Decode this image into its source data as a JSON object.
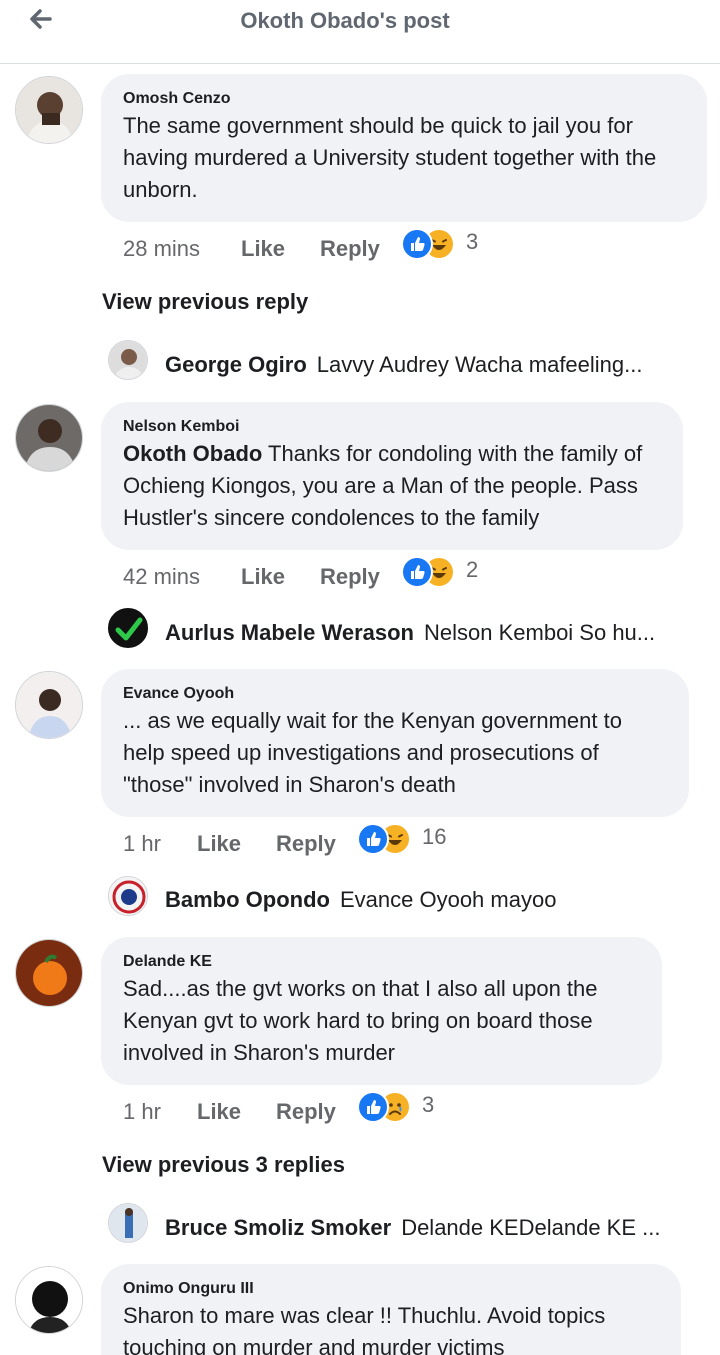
{
  "header": {
    "title": "Okoth Obado's post",
    "back_icon": "back-arrow-icon"
  },
  "comments": [
    {
      "author": "Omosh Cenzo",
      "text": "The same government should be quick to jail you for having murdered a University student together with the unborn.",
      "time": "28 mins",
      "like": "Like",
      "reply": "Reply",
      "reaction_count": "3",
      "reactions": [
        "like",
        "haha"
      ]
    },
    {
      "author": "Nelson Kemboi",
      "mention": "Okoth Obado",
      "text": " Thanks for condoling with the family of Ochieng Kiongos, you are a Man of the people. Pass Hustler's sincere condolences to the family",
      "time": "42 mins",
      "like": "Like",
      "reply": "Reply",
      "reaction_count": "2",
      "reactions": [
        "like",
        "haha"
      ]
    },
    {
      "author": "Evance Oyooh",
      "text": "... as we equally wait for the Kenyan government to help speed up investigations and prosecutions of \"those\" involved in Sharon's death",
      "time": "1 hr",
      "like": "Like",
      "reply": "Reply",
      "reaction_count": "16",
      "reactions": [
        "like",
        "haha"
      ]
    },
    {
      "author": "Delande KE",
      "text": "Sad....as the gvt works on that I also all upon the Kenyan gvt to work hard to bring on board those involved in Sharon's murder",
      "time": "1 hr",
      "like": "Like",
      "reply": "Reply",
      "reaction_count": "3",
      "reactions": [
        "like",
        "sad"
      ]
    },
    {
      "author": "Onimo Onguru III",
      "text": "Sharon to mare was clear !! Thuchlu.  Avoid topics touching on murder and murder victims"
    }
  ],
  "view_previous": [
    "View previous reply",
    "View previous 3 replies"
  ],
  "replies": [
    {
      "name": "George Ogiro",
      "text": "Lavvy Audrey Wacha mafeeling..."
    },
    {
      "name": "Aurlus Mabele Werason",
      "text": "Nelson Kemboi So hu..."
    },
    {
      "name": "Bambo Opondo",
      "text": "Evance Oyooh mayoo"
    },
    {
      "name": "Bruce Smoliz Smoker",
      "text": "Delande KEDelande KE ..."
    }
  ],
  "colors": {
    "like_blue": "#1877f2",
    "haha_yellow": "#f7b125",
    "bubble": "#f0f2f5",
    "muted": "#65676b"
  }
}
